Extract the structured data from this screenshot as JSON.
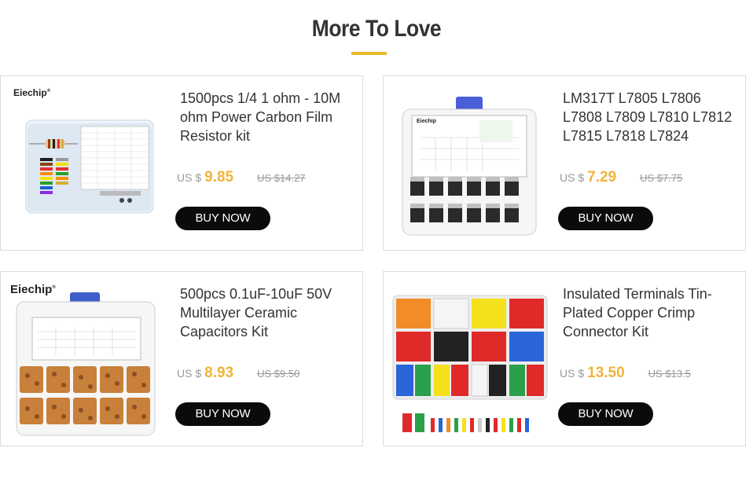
{
  "section": {
    "title": "More To Love"
  },
  "products": [
    {
      "name": "1500pcs 1/4 1 ohm - 10M ohm Power Carbon Film Resistor kit",
      "currency": "US $",
      "price": "9.85",
      "old_price": "US $14.27",
      "button": "BUY NOW",
      "brand": "Eiechip",
      "image": "resistor-kit-box"
    },
    {
      "name": "LM317T L7805 L7806 L7808 L7809 L7810 L7812 L7815 L7818 L7824",
      "currency": "US $",
      "price": "7.29",
      "old_price": "US $7.75",
      "button": "BUY NOW",
      "brand": "Eiechip",
      "image": "regulator-kit-box"
    },
    {
      "name": "500pcs 0.1uF-10uF 50V Multilayer Ceramic Capacitors Kit",
      "currency": "US $",
      "price": "8.93",
      "old_price": "US $9.50",
      "button": "BUY NOW",
      "brand": "Eiechip",
      "image": "capacitor-kit-box"
    },
    {
      "name": "Insulated Terminals Tin-Plated Copper Crimp Connector Kit",
      "currency": "US $",
      "price": "13.50",
      "old_price": "US $13.5",
      "button": "BUY NOW",
      "brand": "",
      "image": "terminal-kit-box"
    }
  ],
  "colors": {
    "accent": "#f0b43c",
    "underline": "#e8b92b",
    "button": "#0b0b0b"
  }
}
